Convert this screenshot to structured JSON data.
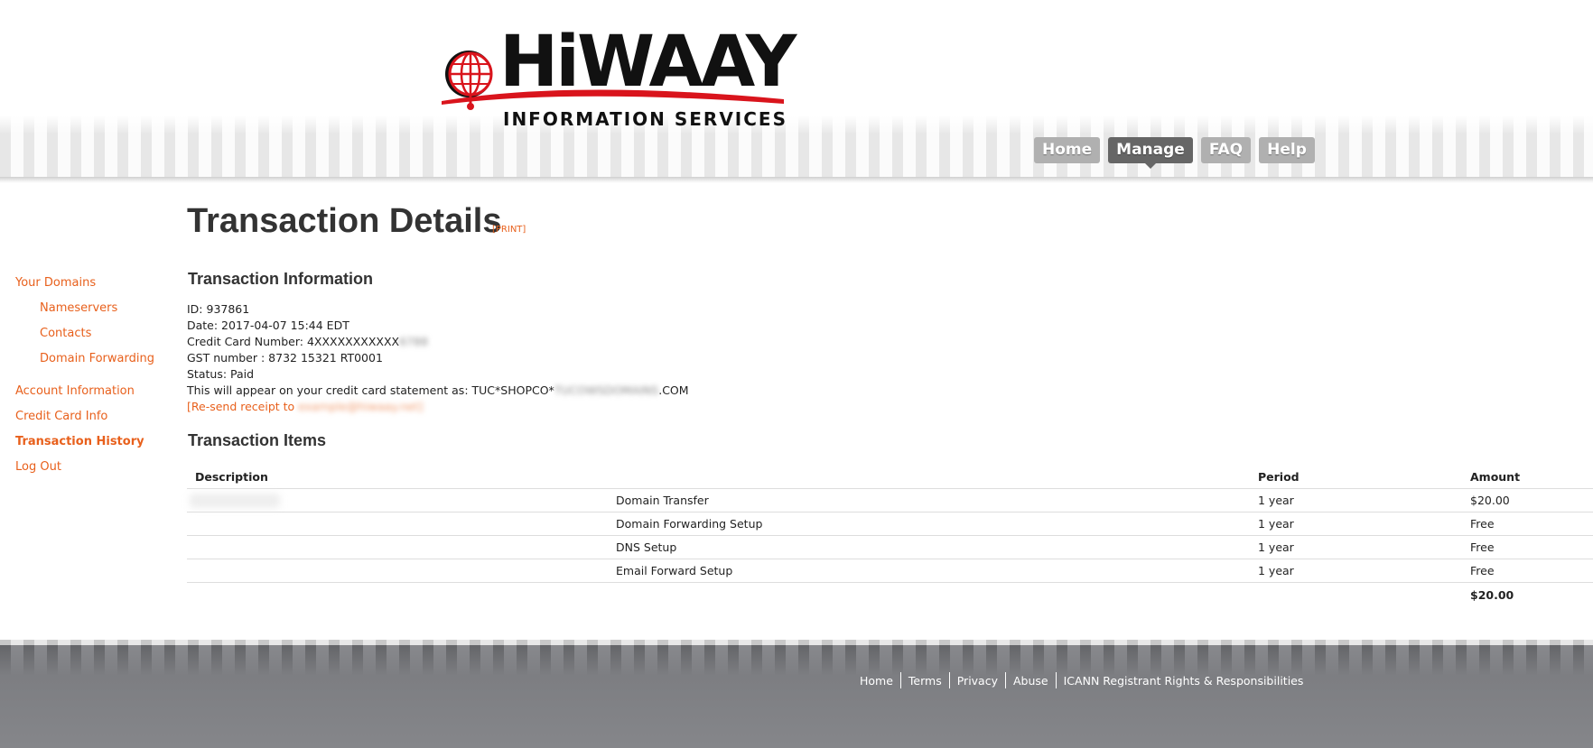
{
  "brand": {
    "logo_word": "HiWAAY",
    "logo_subtitle": "INFORMATION SERVICES",
    "colors": {
      "accent": "#e8601c",
      "logo_red": "#d9141c",
      "nav_inactive": "#b0b0b0",
      "nav_active": "#666666",
      "footer": "#7d7e82"
    }
  },
  "nav": {
    "items": [
      {
        "label": "Home",
        "active": false
      },
      {
        "label": "Manage",
        "active": true
      },
      {
        "label": "FAQ",
        "active": false
      },
      {
        "label": "Help",
        "active": false
      }
    ]
  },
  "sidebar": {
    "items": [
      {
        "label": "Your Domains",
        "indent": false,
        "active": false
      },
      {
        "label": "Nameservers",
        "indent": true,
        "active": false
      },
      {
        "label": "Contacts",
        "indent": true,
        "active": false
      },
      {
        "label": "Domain Forwarding",
        "indent": true,
        "active": false
      },
      {
        "label": "Account Information",
        "indent": false,
        "active": false
      },
      {
        "label": "Credit Card Info",
        "indent": false,
        "active": false
      },
      {
        "label": "Transaction History",
        "indent": false,
        "active": true
      },
      {
        "label": "Log Out",
        "indent": false,
        "active": false
      }
    ]
  },
  "page": {
    "title": "Transaction Details",
    "print_label": "[PRINT]"
  },
  "transaction_info": {
    "heading": "Transaction Information",
    "id_line": "ID: 937861",
    "date_line": "Date: 2017-04-07 15:44 EDT",
    "card_prefix": "Credit Card Number: 4XXXXXXXXXXX",
    "card_hidden": "6788",
    "gst_line": "GST number : 8732 15321 RT0001",
    "status_line": "Status: Paid",
    "statement_prefix": "This will appear on your credit card statement as: TUC*SHOPCO*",
    "statement_hidden": "TUCOWSDOMAINS",
    "statement_suffix": ".COM",
    "resend_prefix": "[Re-send receipt to",
    "resend_hidden": "example@hiwaay.net]"
  },
  "transaction_items": {
    "heading": "Transaction Items",
    "columns": {
      "description": "Description",
      "item": "",
      "period": "Period",
      "amount": "Amount"
    },
    "rows": [
      {
        "item": "Domain Transfer",
        "period": "1 year",
        "amount": "$20.00"
      },
      {
        "item": "Domain Forwarding Setup",
        "period": "1 year",
        "amount": "Free"
      },
      {
        "item": "DNS Setup",
        "period": "1 year",
        "amount": "Free"
      },
      {
        "item": "Email Forward Setup",
        "period": "1 year",
        "amount": "Free"
      }
    ],
    "total": "$20.00"
  },
  "footer": {
    "links": [
      "Home",
      "Terms",
      "Privacy",
      "Abuse",
      "ICANN Registrant Rights & Responsibilities"
    ]
  }
}
